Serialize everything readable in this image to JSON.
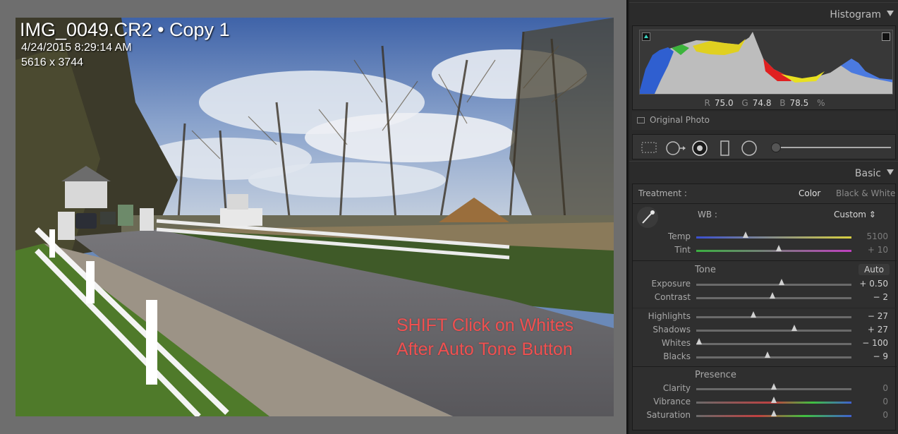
{
  "photo": {
    "filename": "IMG_0049.CR2 • Copy 1",
    "datetime": "4/24/2015 8:29:14 AM",
    "dimensions": "5616 x 3744",
    "annotation_line1": "SHIFT Click on Whites",
    "annotation_line2": "After Auto Tone Button"
  },
  "histogram": {
    "title": "Histogram",
    "r_label": "R",
    "r_value": "75.0",
    "g_label": "G",
    "g_value": "74.8",
    "b_label": "B",
    "b_value": "78.5",
    "unit": "%",
    "original_photo": "Original Photo"
  },
  "basic": {
    "title": "Basic",
    "treatment_label": "Treatment :",
    "treatment_color": "Color",
    "treatment_bw": "Black & White",
    "wb_label": "WB :",
    "wb_value": "Custom",
    "tone_title": "Tone",
    "auto_label": "Auto",
    "presence_title": "Presence",
    "sliders": {
      "temp": {
        "label": "Temp",
        "value": "5100",
        "pos": 0.32
      },
      "tint": {
        "label": "Tint",
        "value": "+ 10",
        "pos": 0.53
      },
      "exposure": {
        "label": "Exposure",
        "value": "+ 0.50",
        "pos": 0.55
      },
      "contrast": {
        "label": "Contrast",
        "value": "− 2",
        "pos": 0.49
      },
      "highlights": {
        "label": "Highlights",
        "value": "− 27",
        "pos": 0.37
      },
      "shadows": {
        "label": "Shadows",
        "value": "+ 27",
        "pos": 0.63
      },
      "whites": {
        "label": "Whites",
        "value": "− 100",
        "pos": 0.02
      },
      "blacks": {
        "label": "Blacks",
        "value": "− 9",
        "pos": 0.46
      },
      "clarity": {
        "label": "Clarity",
        "value": "0",
        "pos": 0.5
      },
      "vibrance": {
        "label": "Vibrance",
        "value": "0",
        "pos": 0.5
      },
      "saturation": {
        "label": "Saturation",
        "value": "0",
        "pos": 0.5
      }
    }
  },
  "colors": {
    "annotation": "#f05050",
    "panel_bg": "#2a2a2a",
    "clip_indicator": "#3ad7c4"
  }
}
